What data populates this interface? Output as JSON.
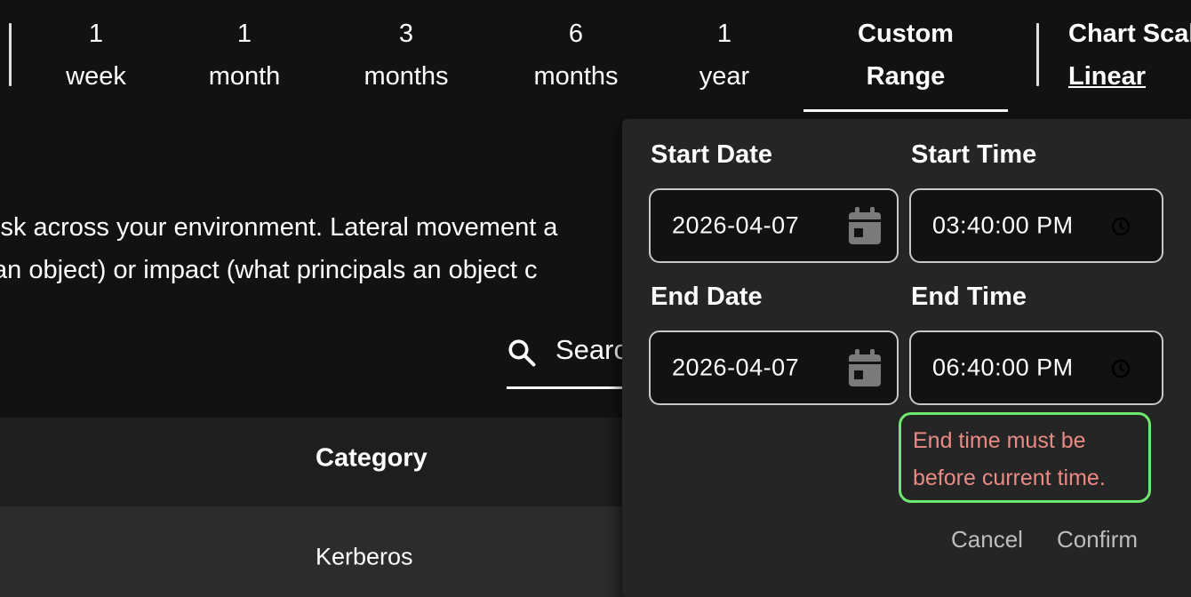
{
  "range_tabs": [
    {
      "line1": "1",
      "line2": "week"
    },
    {
      "line1": "1",
      "line2": "month"
    },
    {
      "line1": "3",
      "line2": "months"
    },
    {
      "line1": "6",
      "line2": "months"
    },
    {
      "line1": "1",
      "line2": "year"
    },
    {
      "line1": "Custom",
      "line2": "Range"
    }
  ],
  "active_tab": "Custom Range",
  "chart_scale": {
    "title": "Chart Scale",
    "value": "Linear"
  },
  "description": {
    "line1": "isk across your environment. Lateral movement a",
    "line2": "an object) or impact (what principals an object c"
  },
  "search": {
    "placeholder": "Search"
  },
  "table": {
    "header": {
      "category": "Category"
    },
    "rows": [
      {
        "category": "Kerberos"
      }
    ]
  },
  "custom_range": {
    "start_date_label": "Start Date",
    "start_date": "2026-04-07",
    "start_time_label": "Start Time",
    "start_time": "03:40:00 PM",
    "end_date_label": "End Date",
    "end_date": "2026-04-07",
    "end_time_label": "End Time",
    "end_time": "06:40:00 PM",
    "error_line1": "End time must be",
    "error_line2": "before current time.",
    "cancel_label": "Cancel",
    "confirm_label": "Confirm"
  },
  "colors": {
    "background": "#121212",
    "popover": "#252525",
    "error_text": "#e98a84",
    "error_outline": "#6fe86f"
  },
  "icons": [
    "calendar-icon",
    "clock-icon",
    "search-icon"
  ]
}
